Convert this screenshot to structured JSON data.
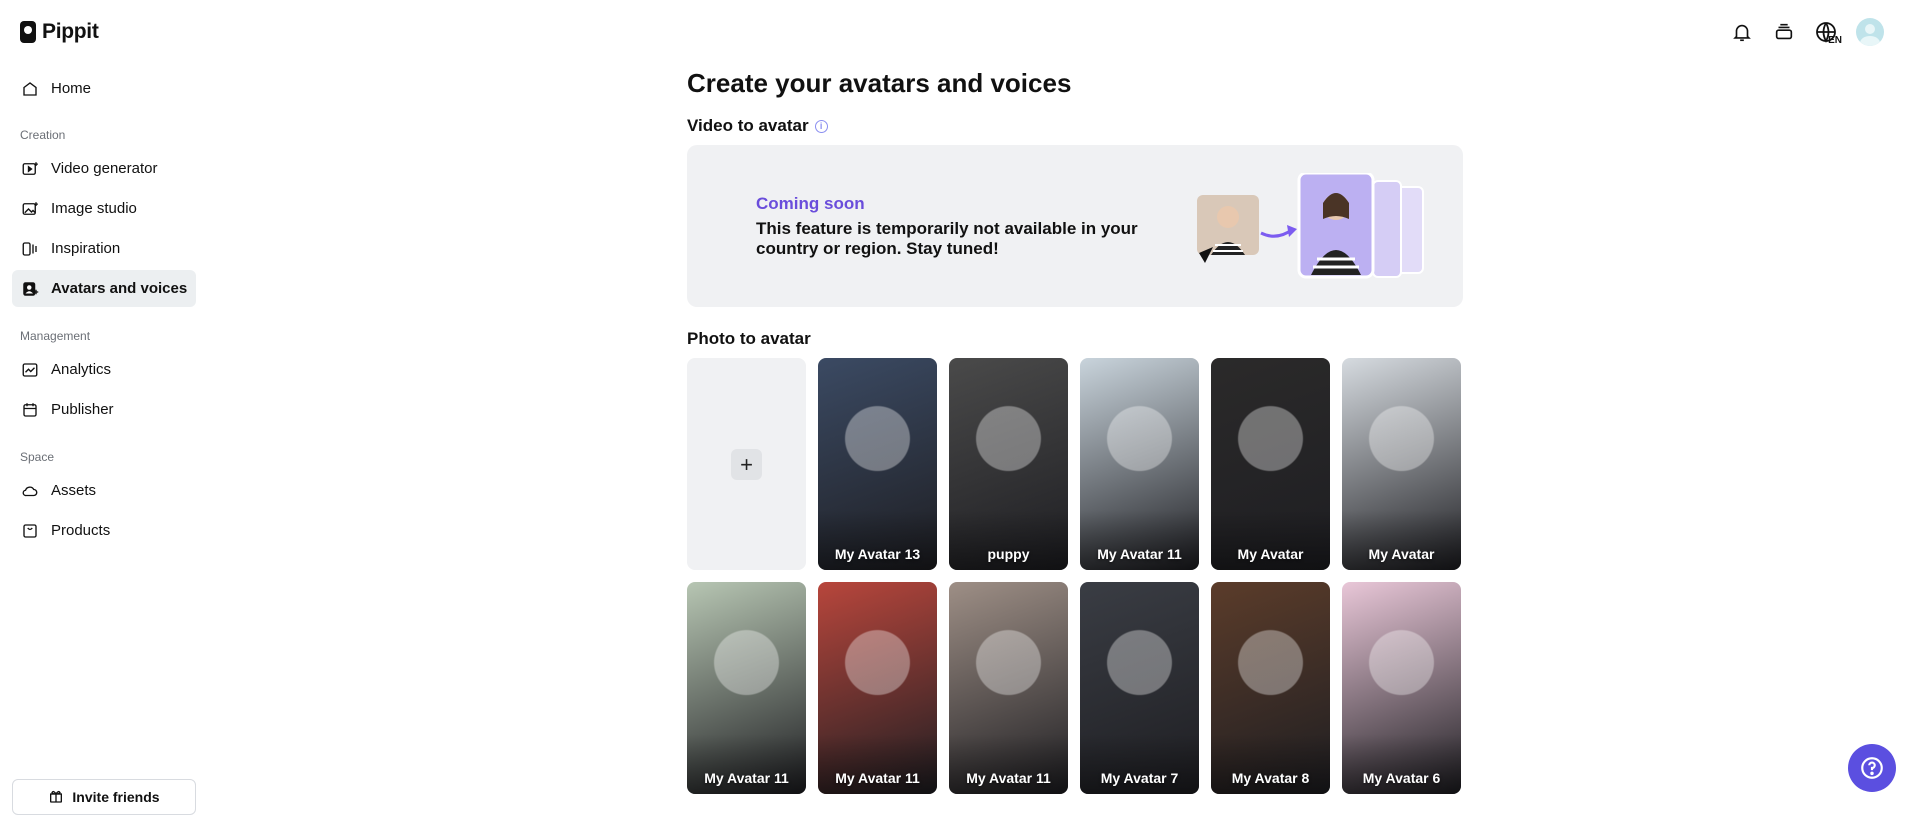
{
  "app": {
    "logo_text": "Pippit"
  },
  "sidebar": {
    "home": "Home",
    "creation_label": "Creation",
    "creation_items": [
      "Video generator",
      "Image studio",
      "Inspiration",
      "Avatars and voices"
    ],
    "management_label": "Management",
    "management_items": [
      "Analytics",
      "Publisher"
    ],
    "space_label": "Space",
    "space_items": [
      "Assets",
      "Products"
    ],
    "invite_label": "Invite friends"
  },
  "topbar": {
    "lang_code": "EN",
    "icons": [
      "bell-icon",
      "layers-icon",
      "globe-icon",
      "user-avatar"
    ]
  },
  "main": {
    "title": "Create your avatars and voices",
    "video_section": "Video to avatar",
    "banner": {
      "status": "Coming soon",
      "message": "This feature is temporarily not available in your country or region. Stay tuned!"
    },
    "photo_section": "Photo to avatar",
    "avatars_row1": [
      {
        "name": "My Avatar 13",
        "tone": "#3b4a63"
      },
      {
        "name": "puppy",
        "tone": "#4a4a4a"
      },
      {
        "name": "My Avatar 11",
        "tone": "#c9d4dc"
      },
      {
        "name": "My Avatar",
        "tone": "#2b2a2a"
      },
      {
        "name": "My Avatar",
        "tone": "#d6dbe0"
      }
    ],
    "avatars_row2": [
      {
        "name": "My Avatar 11",
        "tone": "#b7c6b3"
      },
      {
        "name": "My Avatar 11",
        "tone": "#b8463c"
      },
      {
        "name": "My Avatar 11",
        "tone": "#9e8f86"
      },
      {
        "name": "My Avatar 7",
        "tone": "#3a3d44"
      },
      {
        "name": "My Avatar 8",
        "tone": "#5b3c2a"
      },
      {
        "name": "My Avatar 6",
        "tone": "#e9c7d8"
      }
    ]
  },
  "colors": {
    "accent": "#5b4fe0",
    "coming_soon": "#6a4ddb",
    "active_nav": "#eceff1"
  }
}
